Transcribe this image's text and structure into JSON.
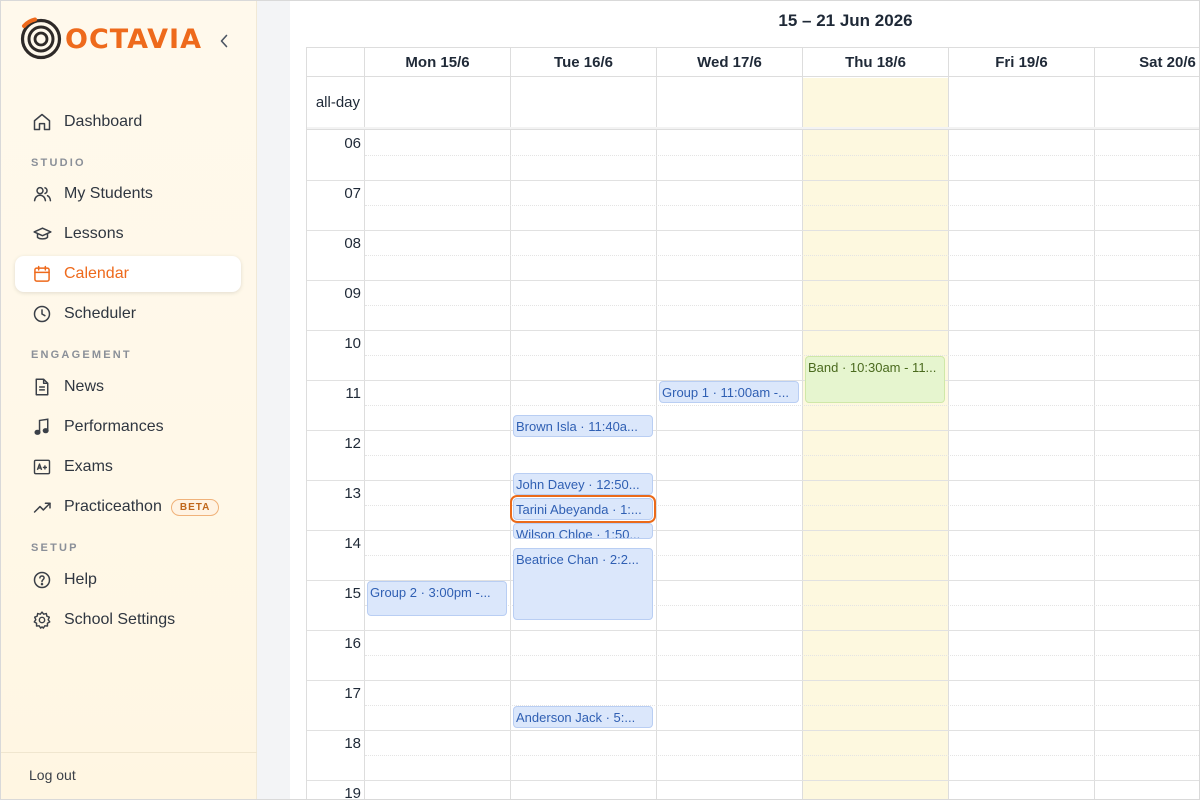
{
  "app": {
    "name": "OCTAVIA",
    "brand_color": "#ee6a1c"
  },
  "sidebar": {
    "collapse_icon": "chevron-left-icon",
    "items": [
      {
        "key": "dashboard",
        "label": "Dashboard",
        "icon": "home-icon"
      },
      {
        "key": "my-students",
        "label": "My Students",
        "icon": "users-icon"
      },
      {
        "key": "lessons",
        "label": "Lessons",
        "icon": "graduation-cap-icon"
      },
      {
        "key": "calendar",
        "label": "Calendar",
        "icon": "calendar-icon",
        "active": true
      },
      {
        "key": "scheduler",
        "label": "Scheduler",
        "icon": "clock-icon"
      },
      {
        "key": "news",
        "label": "News",
        "icon": "document-icon"
      },
      {
        "key": "performances",
        "label": "Performances",
        "icon": "music-note-icon"
      },
      {
        "key": "exams",
        "label": "Exams",
        "icon": "grade-icon"
      },
      {
        "key": "practiceathon",
        "label": "Practiceathon",
        "icon": "trending-up-icon",
        "badge": "BETA"
      },
      {
        "key": "help",
        "label": "Help",
        "icon": "help-circle-icon"
      },
      {
        "key": "school-settings",
        "label": "School Settings",
        "icon": "gear-icon"
      }
    ],
    "sections": {
      "studio": "STUDIO",
      "engagement": "ENGAGEMENT",
      "setup": "SETUP"
    },
    "logout": "Log out"
  },
  "calendar": {
    "title": "15 – 21 Jun 2026",
    "allday_label": "all-day",
    "today_color": "#fdf8df",
    "days": [
      "Mon 15/6",
      "Tue 16/6",
      "Wed 17/6",
      "Thu 18/6",
      "Fri 19/6",
      "Sat 20/6"
    ],
    "today_index": 3,
    "hours": [
      "06",
      "07",
      "08",
      "09",
      "10",
      "11",
      "12",
      "13",
      "14",
      "15",
      "16",
      "17",
      "18",
      "19"
    ],
    "first_hour": 6,
    "events": [
      {
        "day": 0,
        "text": "Group 2 · 3:00pm -...",
        "start": 15.0,
        "end": 15.75,
        "color": "blue"
      },
      {
        "day": 1,
        "text": "Brown Isla · 11:40a...",
        "start": 11.67,
        "end": 12.17,
        "color": "blue"
      },
      {
        "day": 1,
        "text": "John Davey · 12:50...",
        "start": 12.83,
        "end": 13.33,
        "color": "blue"
      },
      {
        "day": 1,
        "text": "Tarini Abeyanda · 1:...",
        "start": 13.33,
        "end": 13.83,
        "color": "blue",
        "focused": true
      },
      {
        "day": 1,
        "text": "Wilson Chloe · 1:50...",
        "start": 13.83,
        "end": 14.17,
        "color": "blue"
      },
      {
        "day": 1,
        "text": "Beatrice Chan · 2:2...",
        "start": 14.33,
        "end": 15.83,
        "color": "blue"
      },
      {
        "day": 1,
        "text": "Anderson Jack · 5:...",
        "start": 17.5,
        "end": 18.0,
        "color": "blue"
      },
      {
        "day": 2,
        "text": "Group 1 · 11:00am -...",
        "start": 11.0,
        "end": 11.5,
        "color": "blue"
      },
      {
        "day": 3,
        "text": "Band · 10:30am - 11...",
        "start": 10.5,
        "end": 11.5,
        "color": "green"
      }
    ]
  }
}
